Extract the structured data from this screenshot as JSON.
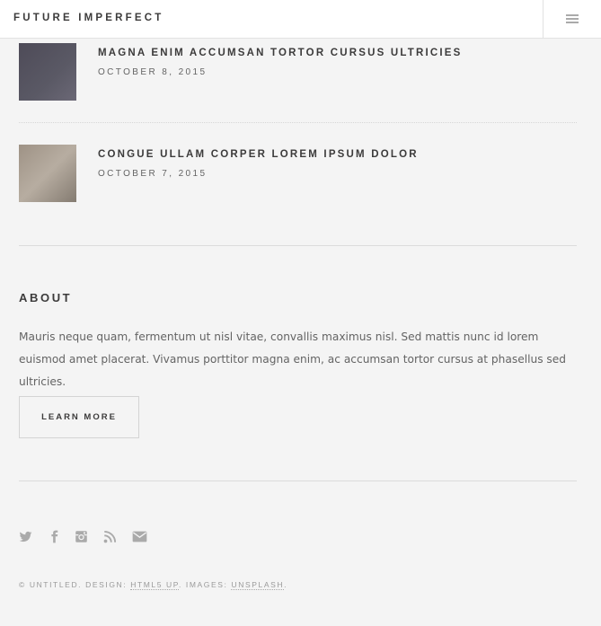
{
  "header": {
    "brand": "FUTURE IMPERFECT",
    "menu_icon": "hamburger-menu-icon"
  },
  "posts": [
    {
      "title": "MAGNA ENIM ACCUMSAN TORTOR CURSUS ULTRICIES",
      "date": "OCTOBER 8, 2015"
    },
    {
      "title": "CONGUE ULLAM CORPER LOREM IPSUM DOLOR",
      "date": "OCTOBER 7, 2015"
    }
  ],
  "about": {
    "heading": "ABOUT",
    "text": "Mauris neque quam, fermentum ut nisl vitae, convallis maximus nisl. Sed mattis nunc id lorem euismod amet placerat. Vivamus porttitor magna enim, ac accumsan tortor cursus at phasellus sed ultricies.",
    "button_label": "LEARN MORE"
  },
  "social_icons": [
    "twitter-icon",
    "facebook-icon",
    "instagram-icon",
    "rss-icon",
    "envelope-icon"
  ],
  "footer": {
    "prefix": "© UNTITLED. DESIGN: ",
    "design_link": "HTML5 UP",
    "middle": ". IMAGES: ",
    "images_link": "UNSPLASH",
    "suffix": "."
  },
  "colors": {
    "background": "#f4f4f4",
    "header_background": "#ffffff",
    "text_dark": "#3c3b3b",
    "text_muted": "#646464",
    "icon_gray": "#aaaaaa"
  }
}
